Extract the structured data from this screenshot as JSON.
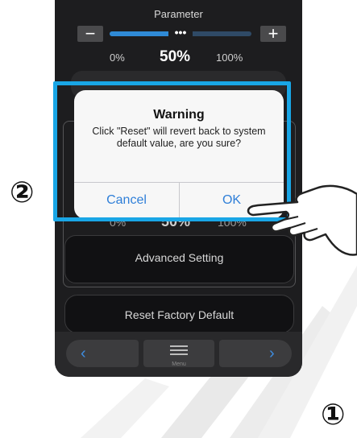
{
  "app": {
    "parameter_title": "Parameter",
    "slider": {
      "value_label": "50%",
      "min_label": "0%",
      "max_label": "100%",
      "value_fraction": 0.5,
      "thumb_symbol": "•••"
    },
    "minus_symbol": "−",
    "plus_symbol": "+",
    "second_percent": {
      "min_label": "0%",
      "value_label": "50%",
      "max_label": "100%"
    },
    "advanced_setting_label": "Advanced Setting",
    "reset_factory_default_label": "Reset Factory Default",
    "bottom_nav": {
      "prev_icon": "chevron-left-icon",
      "prev_symbol": "‹",
      "menu_icon": "menu-icon",
      "menu_label": "Menu",
      "next_icon": "chevron-right-icon",
      "next_symbol": "›"
    }
  },
  "dialog": {
    "title": "Warning",
    "message": "Click \"Reset\" will revert back to system default value, are you sure?",
    "cancel_label": "Cancel",
    "ok_label": "OK"
  },
  "annotations": {
    "step_2": "②",
    "step_1": "①"
  },
  "colors": {
    "highlight": "#19a6e6",
    "accent": "#2f8ad6",
    "button_text": "#2f7fd8",
    "phone_bg": "#1d1d1f"
  }
}
